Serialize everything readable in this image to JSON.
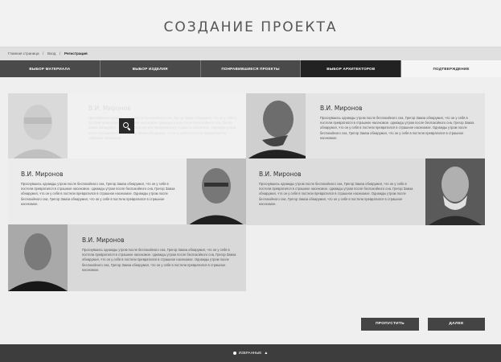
{
  "header": {
    "title": "СОЗДАНИЕ ПРОЕКТА"
  },
  "breadcrumb": {
    "items": [
      "Главная страница",
      "Вход",
      "Регистрация"
    ],
    "separator": "/"
  },
  "steps": [
    {
      "label": "ВЫБОР МАТЕРИАЛА",
      "active": false
    },
    {
      "label": "ВЫБОР ИЗДЕЛИЯ",
      "active": false
    },
    {
      "label": "ПОНРАВИВШИЕСЯ ПРОЕКТЫ",
      "active": false
    },
    {
      "label": "ВЫБОР АРХИТЕКТОРОВ",
      "active": true
    },
    {
      "label": "ПОДТВЕРЖДЕНИЕ",
      "active": false
    }
  ],
  "architects": [
    {
      "name": "В.И. Миронов",
      "bio": "Проснувшись однажды утром после беспокойного сна, Грегор Замза обнаружил, что он у себя в постели превратился в страшное насекомое. однажды утром после беспокойного сна, Грегор Замза обнаружил, что он у себя в постели превратился в страшное насекомое. Однажды утром после беспокойного сна, Грегор Замза обнаружил, что он у себя в постели превратился в страшное насекомое."
    },
    {
      "name": "В.И. Миронов",
      "bio": "Проснувшись однажды утром после беспокойного сна, Грегор Замза обнаружил, что он у себя в постели превратился в страшное насекомое. однажды утром после беспокойного сна, Грегор Замза обнаружил, что он у себя в постели превратился в страшное насекомое. Однажды утром после беспокойного сна, Грегор Замза обнаружил, что он у себя в постели превратился в страшное насекомое."
    },
    {
      "name": "В.И. Миронов",
      "bio": "Проснувшись однажды утром после беспокойного сна, Грегор Замза обнаружил, что он у себя в постели превратился в страшное насекомое. однажды утром после беспокойного сна, Грегор Замза обнаружил, что он у себя в постели превратился в страшное насекомое. Однажды утром после беспокойного сна, Грегор Замза обнаружил, что он у себя в постели превратился в страшное насекомое."
    },
    {
      "name": "В.И. Миронов",
      "bio": "Проснувшись однажды утром после беспокойного сна, Грегор Замза обнаружил, что он у себя в постели превратился в страшное насекомое. однажды утром после беспокойного сна, Грегор Замза обнаружил, что он у себя в постели превратился в страшное насекомое. Однажды утром после беспокойного сна, Грегор Замза обнаружил, что он у себя в постели превратился в страшное насекомое."
    },
    {
      "name": "В.И. Миронов",
      "bio": "Проснувшись однажды утром после беспокойного сна, Грегор Замза обнаружил, что он у себя в постели превратился в страшное насекомое. однажды утром после беспокойного сна, Грегор Замза обнаружил, что он у себя в постели превратился в страшное насекомое. Однажды утром после беспокойного сна, Грегор Замза обнаружил, что он у себя в постели превратился в страшное насекомое."
    }
  ],
  "actions": {
    "skip": "ПРОПУСТИТЬ",
    "next": "ДАЛЕЕ"
  },
  "footer": {
    "favorites": "ИЗБРАННЫЕ"
  },
  "icons": {
    "zoom": "search-icon",
    "favorites": "dot-icon",
    "expand": "arrow-up-icon"
  },
  "colors": {
    "active_step": "#222222",
    "step": "#4a4a4a",
    "button": "#444444",
    "footer": "#3d3d3d"
  }
}
